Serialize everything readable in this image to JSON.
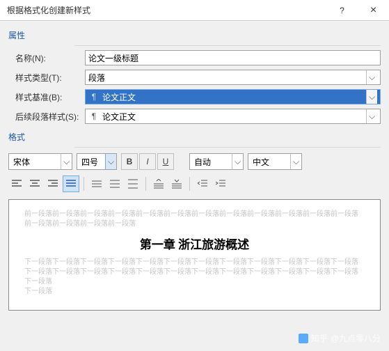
{
  "titlebar": {
    "title": "根据格式化创建新样式",
    "help": "?",
    "close": "×"
  },
  "sections": {
    "properties": "属性",
    "formatting": "格式"
  },
  "labels": {
    "name": "名称(N):",
    "styleType": "样式类型(T):",
    "basedOn": "样式基准(B):",
    "following": "后续段落样式(S):"
  },
  "values": {
    "name": "论文一级标题",
    "styleType": "段落",
    "basedOn": "论文正文",
    "following": "论文正文"
  },
  "format": {
    "font": "宋体",
    "size": "四号",
    "auto": "自动",
    "lang": "中文"
  },
  "buttons": {
    "bold": "B",
    "italic": "I",
    "underline": "U"
  },
  "preview": {
    "before": "前一段落前一段落前一段落前一段落前一段落前一段落前一段落前一段落前一段落前一段落前一段落前一段落前一段落前一段落前一段落前一段落",
    "sample": "第一章 浙江旅游概述",
    "after1": "下一段落下一段落下一段落下一段落下一段落下一段落下一段落下一段落下一段落下一段落下一段落下一段落下一段落下一段落下一段落下一段落下一段落下一段落下一段落下一段落下一段落下一段落下一段落下一段落下一段落",
    "after2": "下一段落"
  },
  "watermark": {
    "brand": "知乎",
    "user": "@九点零八分"
  }
}
